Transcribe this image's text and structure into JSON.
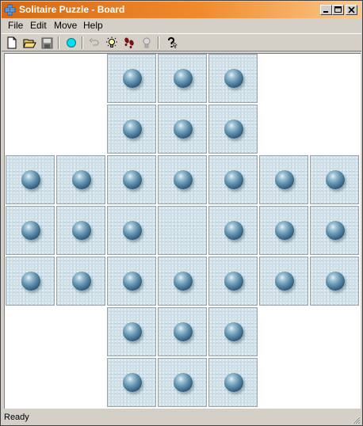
{
  "window": {
    "title": "Solitaire Puzzle - Board",
    "controls": {
      "minimize": "_",
      "maximize": "□",
      "close": "×"
    }
  },
  "menu": {
    "items": [
      {
        "label": "File"
      },
      {
        "label": "Edit"
      },
      {
        "label": "Move"
      },
      {
        "label": "Help"
      }
    ]
  },
  "toolbar": {
    "buttons": [
      {
        "icon": "new-document-icon"
      },
      {
        "icon": "open-folder-icon"
      },
      {
        "icon": "save-disk-icon"
      },
      {
        "icon": "cyan-circle-icon"
      },
      {
        "icon": "undo-icon"
      },
      {
        "icon": "hint-bulb-icon"
      },
      {
        "icon": "footsteps-icon"
      },
      {
        "icon": "lightbulb-off-icon"
      },
      {
        "icon": "help-icon"
      }
    ]
  },
  "board": {
    "layout": [
      "..XXX..",
      "..XXX..",
      "XXXXXXX",
      "XXXXXXX",
      "XXXXXXX",
      "..XXX..",
      "..XXX.."
    ],
    "pegs": [
      "..PPP..",
      "..PPP..",
      "PPPPPPP",
      "PPP.PPP",
      "PPPPPPP",
      "..PPP..",
      "..PPP.."
    ],
    "colors": {
      "cell": "#cfe0e8",
      "peg": "#4f82a3",
      "background": "#ffffff"
    }
  },
  "status": {
    "text": "Ready"
  },
  "colors": {
    "title_bar_start": "#d66a14",
    "title_bar_end": "#fbc98a",
    "chrome": "#d4d0c8"
  }
}
